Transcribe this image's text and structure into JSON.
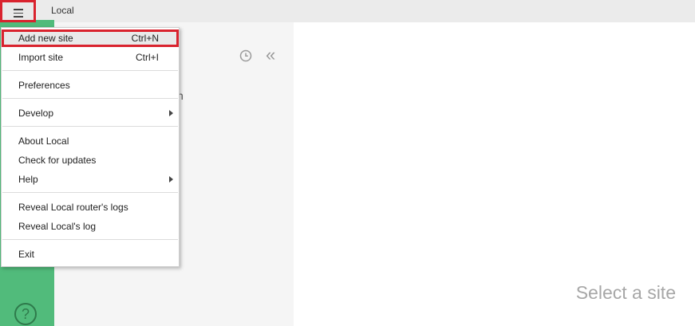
{
  "titlebar": {
    "title": "Local"
  },
  "menu": {
    "items": [
      {
        "label": "Add new site",
        "shortcut": "Ctrl+N"
      },
      {
        "label": "Import site",
        "shortcut": "Ctrl+I"
      },
      {
        "label": "Preferences"
      },
      {
        "label": "Develop"
      },
      {
        "label": "About Local"
      },
      {
        "label": "Check for updates"
      },
      {
        "label": "Help"
      },
      {
        "label": "Reveal Local router's logs"
      },
      {
        "label": "Reveal Local's log"
      },
      {
        "label": "Exit"
      }
    ]
  },
  "sites_panel": {
    "peek_text": "n"
  },
  "rail": {
    "help_glyph": "?"
  },
  "main": {
    "empty_message": "Select a site"
  },
  "colors": {
    "accent_green": "#51bb7b",
    "highlight_red": "#d9232e"
  },
  "icons": [
    "hamburger-icon",
    "history-icon",
    "collapse-icon",
    "help-icon",
    "submenu-arrow-icon"
  ]
}
